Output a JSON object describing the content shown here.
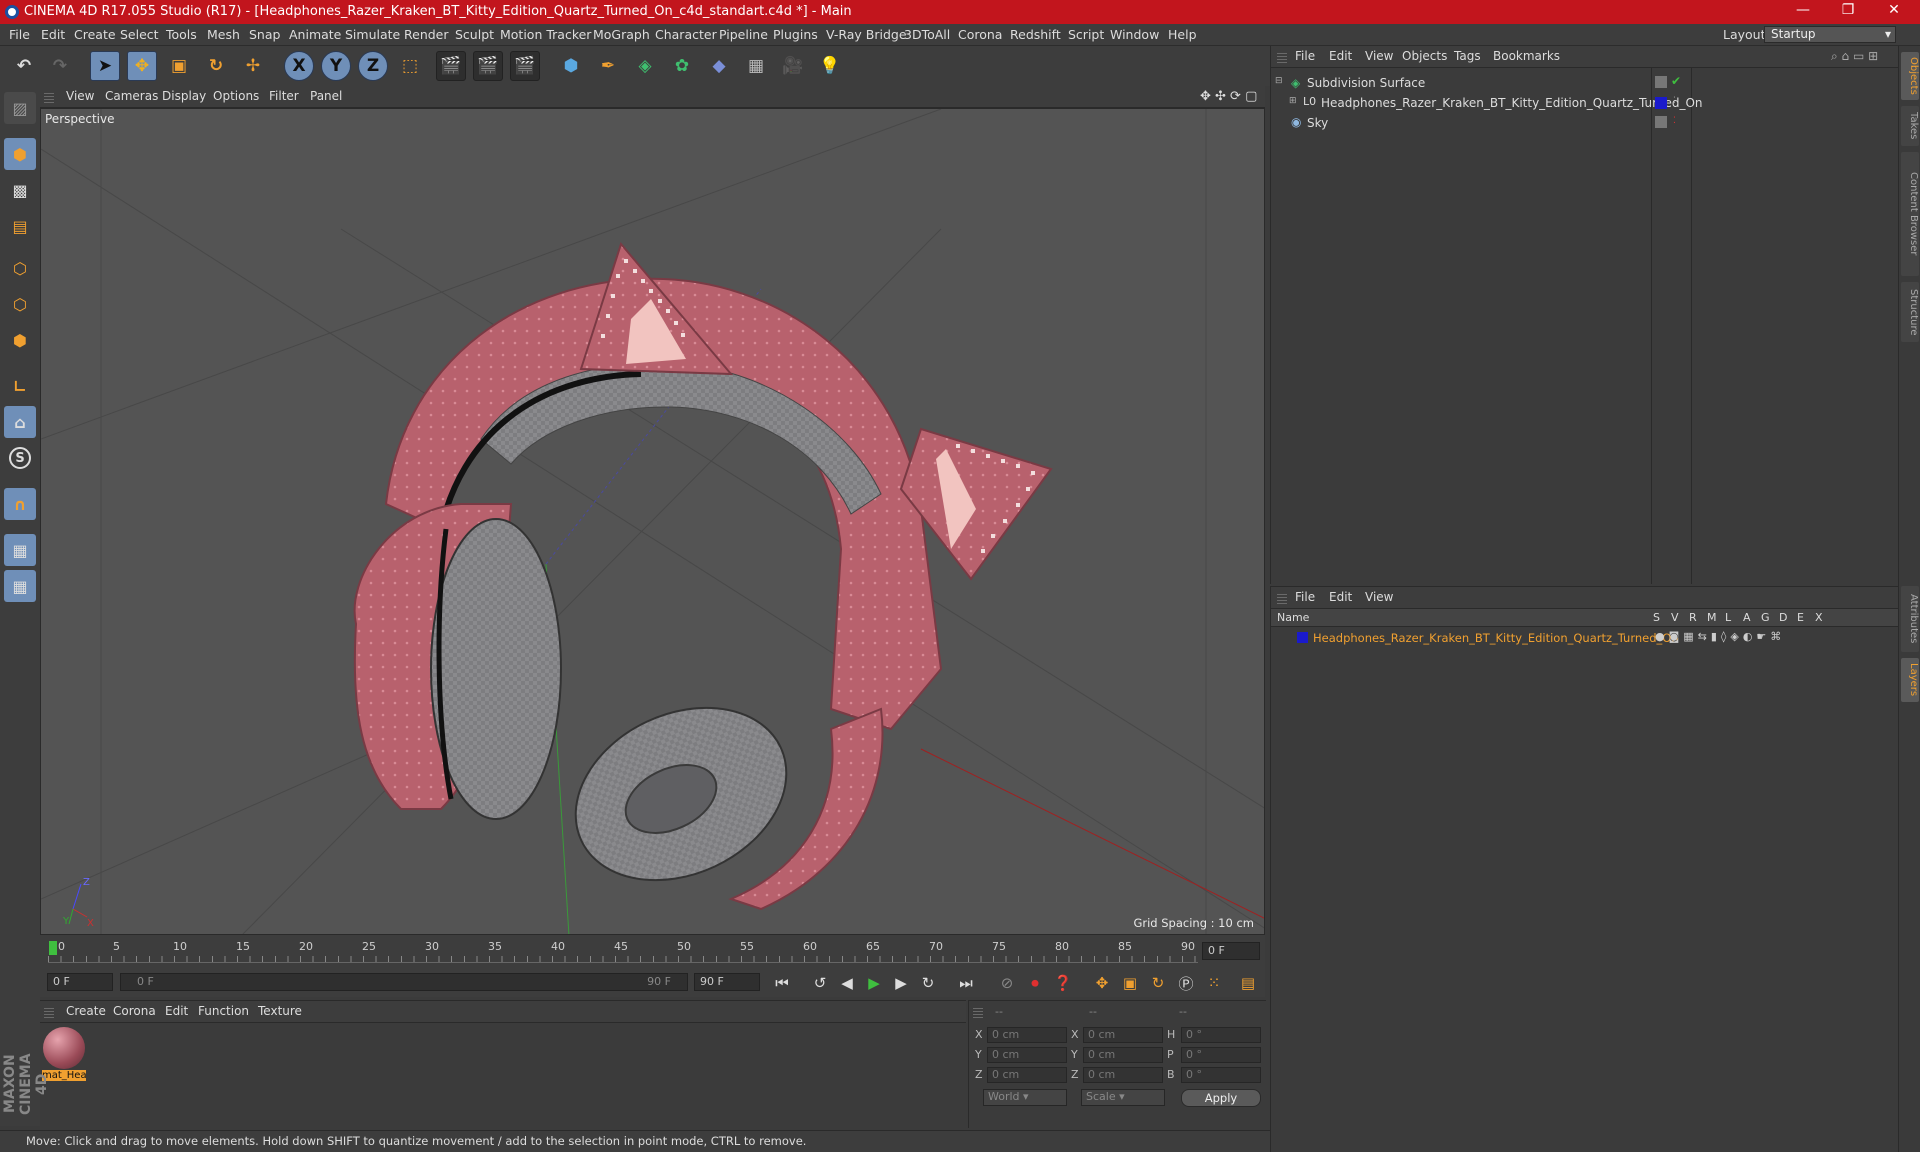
{
  "window": {
    "title": "CINEMA 4D R17.055 Studio (R17) - [Headphones_Razer_Kraken_BT_Kitty_Edition_Quartz_Turned_On_c4d_standart.c4d *] - Main",
    "minimize": "—",
    "maximize": "❐",
    "close": "✕"
  },
  "menubar": {
    "items": [
      "File",
      "Edit",
      "Create",
      "Select",
      "Tools",
      "Mesh",
      "Snap",
      "Animate",
      "Simulate",
      "Render",
      "Sculpt",
      "Motion Tracker",
      "MoGraph",
      "Character",
      "Pipeline",
      "Plugins",
      "V-Ray Bridge",
      "3DToAll",
      "Corona",
      "Redshift",
      "Script",
      "Window",
      "Help"
    ],
    "layout_label": "Layout:",
    "layout_value": "Startup"
  },
  "toolbar": {
    "x_label": "X",
    "y_label": "Y",
    "z_label": "Z"
  },
  "viewport": {
    "menu": [
      "View",
      "Cameras",
      "Display",
      "Options",
      "Filter",
      "Panel"
    ],
    "label": "Perspective",
    "grid_spacing": "Grid Spacing : 10 cm"
  },
  "timeline": {
    "ticks": [
      "0",
      "5",
      "10",
      "15",
      "20",
      "25",
      "30",
      "35",
      "40",
      "45",
      "50",
      "55",
      "60",
      "65",
      "70",
      "75",
      "80",
      "85",
      "90"
    ],
    "current_frame": "0 F"
  },
  "playbar": {
    "start_frame": "0 F",
    "range_start": "0 F",
    "range_end": "90 F",
    "end_frame": "90 F"
  },
  "material_panel": {
    "menu": [
      "Create",
      "Corona",
      "Edit",
      "Function",
      "Texture"
    ],
    "material_name": "mat_Hea"
  },
  "coord_panel": {
    "header": [
      "--",
      "--",
      "--"
    ],
    "rows": [
      {
        "axis": "X",
        "pos": "0 cm",
        "axis2": "X",
        "size": "0 cm",
        "rot_label": "H",
        "rot": "0 °"
      },
      {
        "axis": "Y",
        "pos": "0 cm",
        "axis2": "Y",
        "size": "0 cm",
        "rot_label": "P",
        "rot": "0 °"
      },
      {
        "axis": "Z",
        "pos": "0 cm",
        "axis2": "Z",
        "size": "0 cm",
        "rot_label": "B",
        "rot": "0 °"
      }
    ],
    "world": "World",
    "scale": "Scale",
    "apply": "Apply"
  },
  "object_panel": {
    "menu": [
      "File",
      "Edit",
      "View",
      "Objects",
      "Tags",
      "Bookmarks"
    ],
    "objects": [
      {
        "name": "Subdivision Surface"
      },
      {
        "name": "Headphones_Razer_Kraken_BT_Kitty_Edition_Quartz_Turned_On"
      },
      {
        "name": "Sky"
      }
    ]
  },
  "layer_panel": {
    "menu": [
      "File",
      "Edit",
      "View"
    ],
    "columns": [
      "Name",
      "S",
      "V",
      "R",
      "M",
      "L",
      "A",
      "G",
      "D",
      "E",
      "X"
    ],
    "layer_name": "Headphones_Razer_Kraken_BT_Kitty_Edition_Quartz_Turned_On",
    "layer_color": "#1a1acc"
  },
  "side_tabs": [
    "Objects",
    "Takes",
    "Content Browser",
    "Structure",
    "Attributes",
    "Layers"
  ],
  "status": "Move: Click and drag to move elements. Hold down SHIFT to quantize movement / add to the selection in point mode, CTRL to remove.",
  "brand": "MAXON CINEMA 4D",
  "colors": {
    "title_bar": "#c2151d",
    "accent_orange": "#f0a030",
    "headphone_pink": "#b8616d"
  }
}
